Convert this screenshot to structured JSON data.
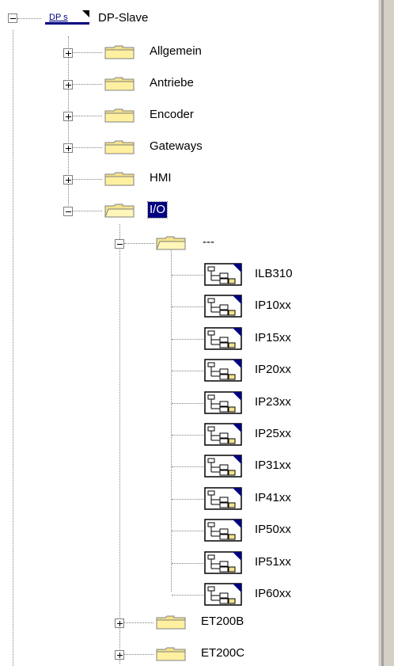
{
  "tree": {
    "root": {
      "label": "DP-Slave",
      "icon_text": "DP s"
    },
    "folders_top": [
      {
        "label": "Allgemein",
        "state": "collapsed"
      },
      {
        "label": "Antriebe",
        "state": "collapsed"
      },
      {
        "label": "Encoder",
        "state": "collapsed"
      },
      {
        "label": "Gateways",
        "state": "collapsed"
      },
      {
        "label": "HMI",
        "state": "collapsed"
      },
      {
        "label": "I/O",
        "state": "expanded",
        "selected": true
      }
    ],
    "subfolder": {
      "label": "---",
      "state": "expanded"
    },
    "devices": [
      "ILB310",
      "IP10xx",
      "IP15xx",
      "IP20xx",
      "IP23xx",
      "IP25xx",
      "IP31xx",
      "IP41xx",
      "IP50xx",
      "IP51xx",
      "IP60xx"
    ],
    "folders_after": [
      {
        "label": "ET200B",
        "state": "collapsed"
      },
      {
        "label": "ET200C",
        "state": "collapsed"
      }
    ]
  },
  "colors": {
    "selection": "#000080",
    "folder": "#f3e38c",
    "scrollbar": "#d4d0c8"
  }
}
